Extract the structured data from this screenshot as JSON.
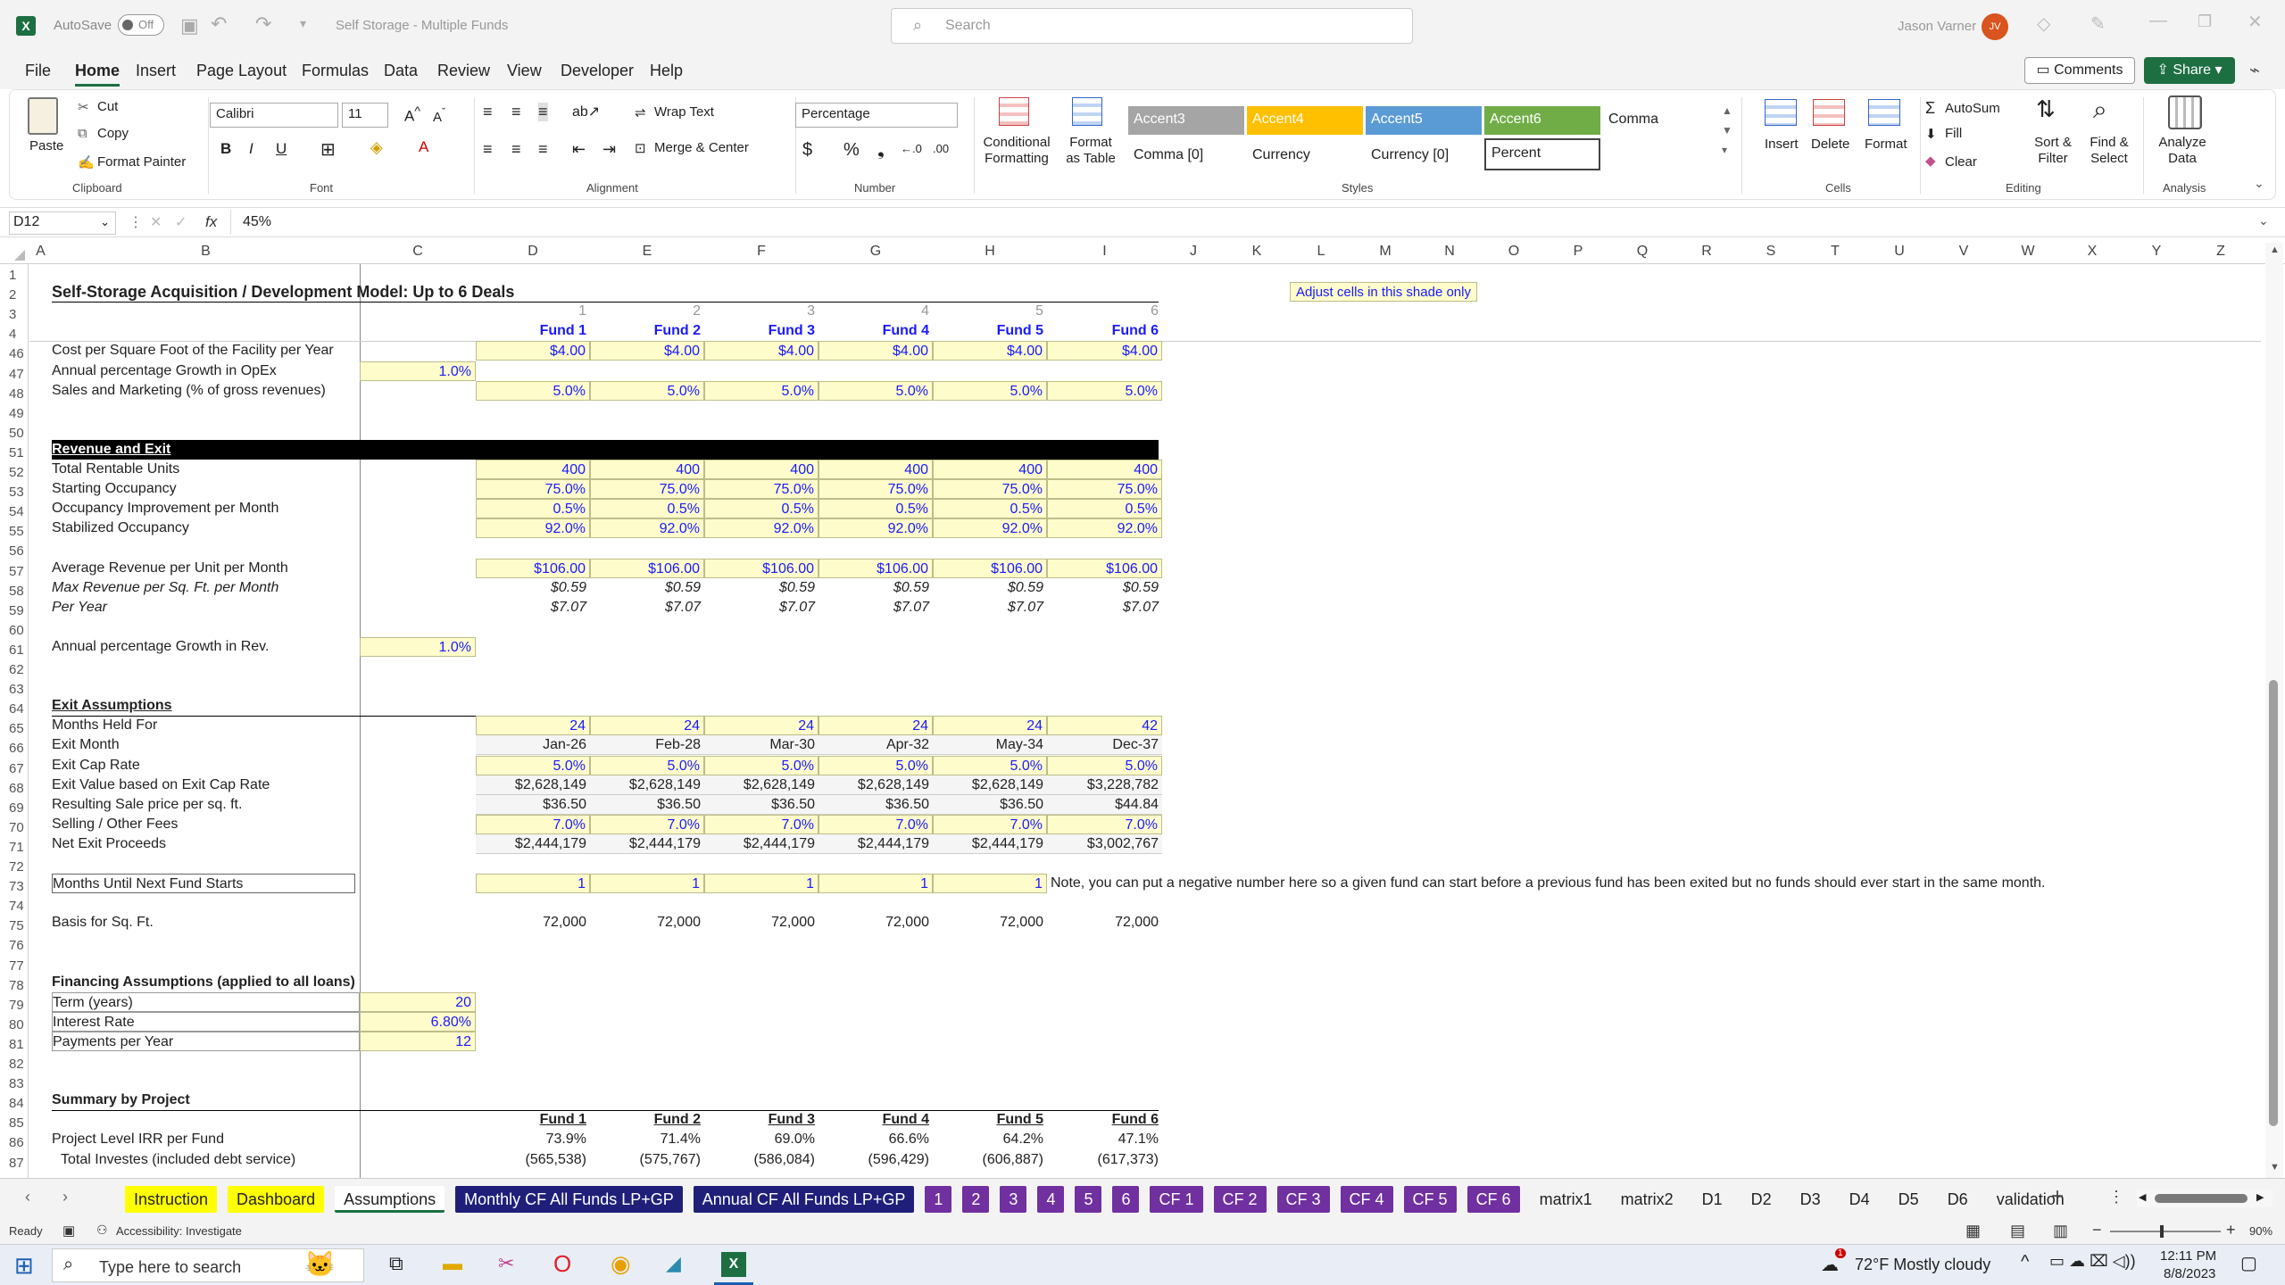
{
  "titlebar": {
    "autosave": "AutoSave",
    "autosave_state": "Off",
    "doc_title": "Self Storage - Multiple Funds",
    "search_placeholder": "Search",
    "user": "Jason Varner",
    "initials": "JV"
  },
  "menu": [
    "File",
    "Home",
    "Insert",
    "Page Layout",
    "Formulas",
    "Data",
    "Review",
    "View",
    "Developer",
    "Help"
  ],
  "menu_right": {
    "comments": "Comments",
    "share": "Share"
  },
  "ribbon": {
    "clipboard": {
      "paste": "Paste",
      "cut": "Cut",
      "copy": "Copy",
      "format_painter": "Format Painter",
      "group": "Clipboard"
    },
    "font": {
      "name": "Calibri",
      "size": "11",
      "group": "Font"
    },
    "alignment": {
      "wrap": "Wrap Text",
      "merge": "Merge & Center",
      "group": "Alignment"
    },
    "number": {
      "format": "Percentage",
      "group": "Number"
    },
    "styles": {
      "cond": "Conditional Formatting",
      "fmt_table": "Format as Table",
      "group": "Styles",
      "cells": [
        {
          "label": "Accent3",
          "color": "#a5a5a5"
        },
        {
          "label": "Accent4",
          "color": "#ffc000"
        },
        {
          "label": "Accent5",
          "color": "#5b9bd5"
        },
        {
          "label": "Accent6",
          "color": "#70ad47"
        },
        {
          "label": "Comma",
          "color": ""
        },
        {
          "label": "Comma [0]",
          "color": ""
        },
        {
          "label": "Currency",
          "color": ""
        },
        {
          "label": "Currency [0]",
          "color": ""
        },
        {
          "label": "Percent",
          "color": ""
        }
      ]
    },
    "cells": {
      "insert": "Insert",
      "delete": "Delete",
      "format": "Format",
      "group": "Cells"
    },
    "editing": {
      "autosum": "AutoSum",
      "fill": "Fill",
      "clear": "Clear",
      "sort": "Sort & Filter",
      "find": "Find & Select",
      "group": "Editing"
    },
    "analysis": {
      "analyze": "Analyze Data",
      "group": "Analysis"
    }
  },
  "formula_bar": {
    "name_box": "D12",
    "fx": "fx",
    "value": "45%"
  },
  "columns": [
    "A",
    "B",
    "C",
    "D",
    "E",
    "F",
    "G",
    "H",
    "I",
    "J",
    "K",
    "L",
    "M",
    "N",
    "O",
    "P",
    "Q",
    "R",
    "S",
    "T",
    "U",
    "V",
    "W",
    "X",
    "Y",
    "Z"
  ],
  "rows": [
    "1",
    "2",
    "3",
    "4",
    "46",
    "47",
    "48",
    "49",
    "50",
    "51",
    "52",
    "53",
    "54",
    "55",
    "56",
    "57",
    "58",
    "59",
    "60",
    "61",
    "62",
    "63",
    "64",
    "65",
    "66",
    "67",
    "68",
    "69",
    "70",
    "71",
    "72",
    "73",
    "74",
    "75",
    "76",
    "77",
    "78",
    "79",
    "80",
    "81",
    "82",
    "83",
    "84",
    "85",
    "86",
    "87"
  ],
  "sheet": {
    "title": "Self-Storage Acquisition / Development Model: Up to 6 Deals",
    "note_shade": "Adjust cells in this shade only",
    "fund_nums": [
      "1",
      "2",
      "3",
      "4",
      "5",
      "6"
    ],
    "funds": [
      "Fund 1",
      "Fund 2",
      "Fund 3",
      "Fund 4",
      "Fund 5",
      "Fund 6"
    ],
    "lbl_cost": "Cost per Square Foot of the Facility per Year",
    "cost": [
      "$4.00",
      "$4.00",
      "$4.00",
      "$4.00",
      "$4.00",
      "$4.00"
    ],
    "lbl_opex": "Annual percentage Growth in OpEx",
    "opex": "1.0%",
    "lbl_sales": "Sales and Marketing (% of gross revenues)",
    "sales": [
      "5.0%",
      "5.0%",
      "5.0%",
      "5.0%",
      "5.0%",
      "5.0%"
    ],
    "rev_header": "Revenue and Exit",
    "lbl_units": "Total Rentable Units",
    "units": [
      "400",
      "400",
      "400",
      "400",
      "400",
      "400"
    ],
    "lbl_occ": "Starting Occupancy",
    "occ": [
      "75.0%",
      "75.0%",
      "75.0%",
      "75.0%",
      "75.0%",
      "75.0%"
    ],
    "lbl_occimp": "Occupancy Improvement per Month",
    "occimp": [
      "0.5%",
      "0.5%",
      "0.5%",
      "0.5%",
      "0.5%",
      "0.5%"
    ],
    "lbl_stab": "Stabilized Occupancy",
    "stab": [
      "92.0%",
      "92.0%",
      "92.0%",
      "92.0%",
      "92.0%",
      "92.0%"
    ],
    "lbl_avgrev": "Average Revenue per Unit per Month",
    "avgrev": [
      "$106.00",
      "$106.00",
      "$106.00",
      "$106.00",
      "$106.00",
      "$106.00"
    ],
    "lbl_maxrev": "Max Revenue per Sq. Ft. per Month",
    "maxrev": [
      "$0.59",
      "$0.59",
      "$0.59",
      "$0.59",
      "$0.59",
      "$0.59"
    ],
    "lbl_peryear": "Per Year",
    "peryear": [
      "$7.07",
      "$7.07",
      "$7.07",
      "$7.07",
      "$7.07",
      "$7.07"
    ],
    "lbl_revgrowth": "Annual percentage Growth in Rev.",
    "revgrowth": "1.0%",
    "exit_header": "Exit Assumptions",
    "lbl_held": "Months Held For",
    "held": [
      "24",
      "24",
      "24",
      "24",
      "24",
      "42"
    ],
    "lbl_exitm": "Exit Month",
    "exitm": [
      "Jan-26",
      "Feb-28",
      "Mar-30",
      "Apr-32",
      "May-34",
      "Dec-37"
    ],
    "lbl_cap": "Exit Cap Rate",
    "cap": [
      "5.0%",
      "5.0%",
      "5.0%",
      "5.0%",
      "5.0%",
      "5.0%"
    ],
    "lbl_exitval": "Exit Value based on Exit Cap Rate",
    "exitval": [
      "$2,628,149",
      "$2,628,149",
      "$2,628,149",
      "$2,628,149",
      "$2,628,149",
      "$3,228,782"
    ],
    "lbl_saleprice": "Resulting Sale price per sq. ft.",
    "saleprice": [
      "$36.50",
      "$36.50",
      "$36.50",
      "$36.50",
      "$36.50",
      "$44.84"
    ],
    "lbl_fees": "Selling / Other Fees",
    "fees": [
      "7.0%",
      "7.0%",
      "7.0%",
      "7.0%",
      "7.0%",
      "7.0%"
    ],
    "lbl_netexit": "Net Exit Proceeds",
    "netexit": [
      "$2,444,179",
      "$2,444,179",
      "$2,444,179",
      "$2,444,179",
      "$2,444,179",
      "$3,002,767"
    ],
    "lbl_months": "Months Until Next Fund Starts",
    "months": [
      "1",
      "1",
      "1",
      "1",
      "1"
    ],
    "months_note": "Note, you can put a negative number here so a given fund can start before a previous fund has been exited but no funds should ever start in the same month.",
    "lbl_basis": "Basis for Sq. Ft.",
    "basis": [
      "72,000",
      "72,000",
      "72,000",
      "72,000",
      "72,000",
      "72,000"
    ],
    "fin_header": "Financing Assumptions (applied to all loans)",
    "lbl_term": "Term (years)",
    "term": "20",
    "lbl_rate": "Interest Rate",
    "rate": "6.80%",
    "lbl_pmts": "Payments per Year",
    "pmts": "12",
    "summary_header": "Summary by Project",
    "lbl_irr": "Project Level IRR per Fund",
    "irr": [
      "73.9%",
      "71.4%",
      "69.0%",
      "66.6%",
      "64.2%",
      "47.1%"
    ],
    "lbl_invest": "Total Investes (included debt service)",
    "invest": [
      "(565,538)",
      "(575,767)",
      "(586,084)",
      "(596,429)",
      "(606,887)",
      "(617,373)"
    ]
  },
  "tabs": [
    {
      "label": "Instruction",
      "bg": "#ffff00",
      "fg": "#222"
    },
    {
      "label": "Dashboard",
      "bg": "#ffff00",
      "fg": "#222"
    },
    {
      "label": "Assumptions",
      "bg": "#ffffff",
      "fg": "#222"
    },
    {
      "label": "Monthly CF All Funds LP+GP",
      "bg": "#1f1f7a",
      "fg": "#fff"
    },
    {
      "label": "Annual CF All Funds LP+GP",
      "bg": "#1f1f7a",
      "fg": "#fff"
    },
    {
      "label": "1",
      "bg": "#7030a0",
      "fg": "#fff"
    },
    {
      "label": "2",
      "bg": "#7030a0",
      "fg": "#fff"
    },
    {
      "label": "3",
      "bg": "#7030a0",
      "fg": "#fff"
    },
    {
      "label": "4",
      "bg": "#7030a0",
      "fg": "#fff"
    },
    {
      "label": "5",
      "bg": "#7030a0",
      "fg": "#fff"
    },
    {
      "label": "6",
      "bg": "#7030a0",
      "fg": "#fff"
    },
    {
      "label": "CF 1",
      "bg": "#7030a0",
      "fg": "#fff"
    },
    {
      "label": "CF 2",
      "bg": "#7030a0",
      "fg": "#fff"
    },
    {
      "label": "CF 3",
      "bg": "#7030a0",
      "fg": "#fff"
    },
    {
      "label": "CF 4",
      "bg": "#7030a0",
      "fg": "#fff"
    },
    {
      "label": "CF 5",
      "bg": "#7030a0",
      "fg": "#fff"
    },
    {
      "label": "CF 6",
      "bg": "#7030a0",
      "fg": "#fff"
    },
    {
      "label": "matrix1",
      "bg": "",
      "fg": "#222"
    },
    {
      "label": "matrix2",
      "bg": "",
      "fg": "#222"
    },
    {
      "label": "D1",
      "bg": "",
      "fg": "#222"
    },
    {
      "label": "D2",
      "bg": "",
      "fg": "#222"
    },
    {
      "label": "D3",
      "bg": "",
      "fg": "#222"
    },
    {
      "label": "D4",
      "bg": "",
      "fg": "#222"
    },
    {
      "label": "D5",
      "bg": "",
      "fg": "#222"
    },
    {
      "label": "D6",
      "bg": "",
      "fg": "#222"
    },
    {
      "label": "validation",
      "bg": "",
      "fg": "#222"
    }
  ],
  "status": {
    "ready": "Ready",
    "accessibility": "Accessibility: Investigate",
    "zoom": "90%"
  },
  "taskbar": {
    "search": "Type here to search",
    "weather": "72°F  Mostly cloudy",
    "time": "12:11 PM",
    "date": "8/8/2023",
    "notif": "1"
  }
}
